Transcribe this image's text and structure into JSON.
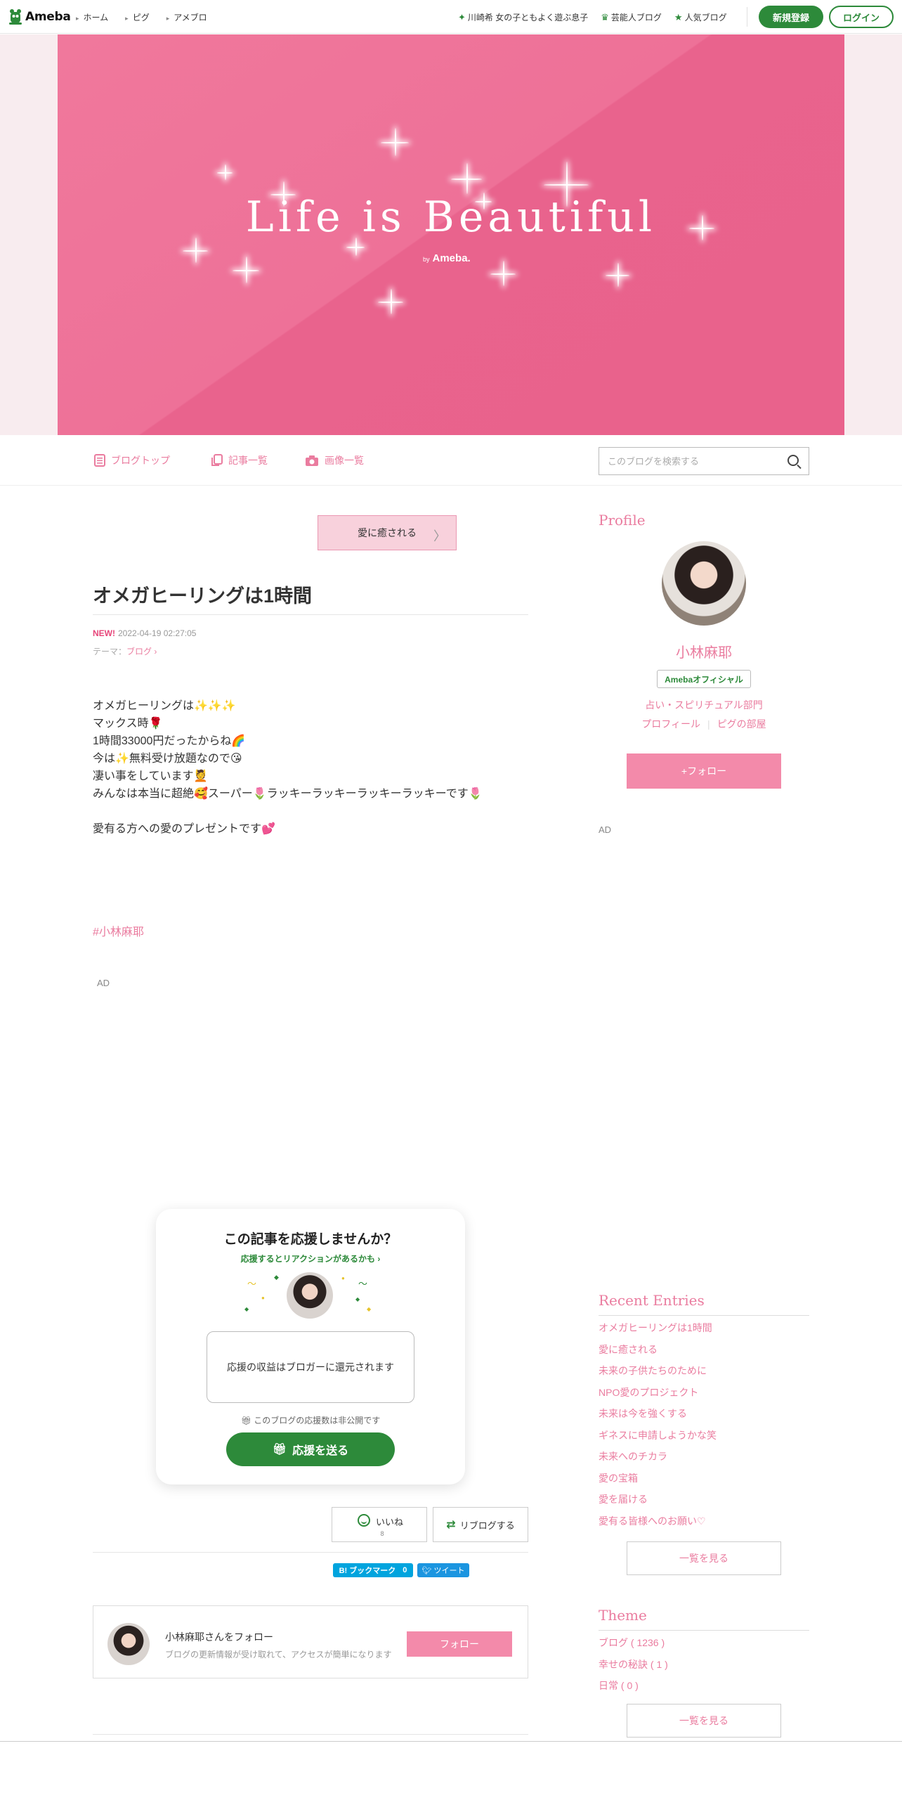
{
  "topbar": {
    "logo_text": "Ameba",
    "nav_left": [
      "ホーム",
      "ピグ",
      "アメブロ"
    ],
    "nav_right": [
      {
        "icon": "sparkle-icon",
        "label": "川崎希 女の子ともよく遊ぶ息子"
      },
      {
        "icon": "crown-icon",
        "label": "芸能人ブログ"
      },
      {
        "icon": "star-icon",
        "label": "人気ブログ"
      }
    ],
    "register_label": "新規登録",
    "login_label": "ログイン",
    "accent_color": "#2d8a3a"
  },
  "header": {
    "title": "Life is Beautiful",
    "by": "by",
    "brand": "Ameba."
  },
  "blognav": {
    "items": [
      {
        "icon": "document-icon",
        "label": "ブログトップ"
      },
      {
        "icon": "copy-icon",
        "label": "記事一覧"
      },
      {
        "icon": "camera-icon",
        "label": "画像一覧"
      }
    ],
    "search_placeholder": "このブログを検索する"
  },
  "article": {
    "prev_label": "愛に癒される",
    "title": "オメガヒーリングは1時間",
    "new_badge": "NEW!",
    "datetime": "2022-04-19 02:27:05",
    "theme_prefix": "テーマ：",
    "theme_name": "ブログ",
    "body_lines": [
      "オメガヒーリングは✨✨✨",
      "マックス時🌹",
      "1時間33000円だったからね🌈",
      "今は✨無料受け放題なので😘",
      "凄い事をしています💆",
      "みんなは本当に超絶🥰スーパー🌷ラッキーラッキーラッキーラッキーです🌷",
      "",
      "愛有る方への愛のプレゼントです💕"
    ],
    "hashtag": "#小林麻耶",
    "ad_label": "AD"
  },
  "support": {
    "question": "この記事を応援しませんか？",
    "sub": "応援するとリアクションがあるかも ›",
    "box_text": "応援の収益はブロガーに還元されます",
    "note": "このブログの応援数は非公開です",
    "send_label": "応援を送る"
  },
  "actions": {
    "like_label": "いいね",
    "like_count": "8",
    "reblog_label": "リブログする",
    "hatena_label": "B! ブックマーク",
    "hatena_count": "0",
    "tweet_label": "ツイート"
  },
  "followbox": {
    "name": "小林麻耶さんをフォロー",
    "desc": "ブログの更新情報が受け取れて、アクセスが簡単になります",
    "button": "フォロー"
  },
  "sidebar": {
    "profile_heading": "Profile",
    "name": "小林麻耶",
    "badge": "Amebaオフィシャル",
    "category": "占い・スピリチュアル部門",
    "link_profile": "プロフィール",
    "link_room": "ピグの部屋",
    "follow": "+フォロー",
    "ad_label": "AD",
    "recent_heading": "Recent Entries",
    "recent": [
      "オメガヒーリングは1時間",
      "愛に癒される",
      "未来の子供たちのために",
      "NPO愛のプロジェクト",
      "未来は今を強くする",
      "ギネスに申請しようかな笑",
      "未来へのチカラ",
      "愛の宝箱",
      "愛を届ける",
      "愛有る皆様へのお願い♡"
    ],
    "more_label": "一覧を見る",
    "theme_heading": "Theme",
    "themes": [
      "ブログ ( 1236 )",
      "幸せの秘訣 ( 1 )",
      "日常 ( 0 )"
    ],
    "pink": "#ea7c9f"
  }
}
